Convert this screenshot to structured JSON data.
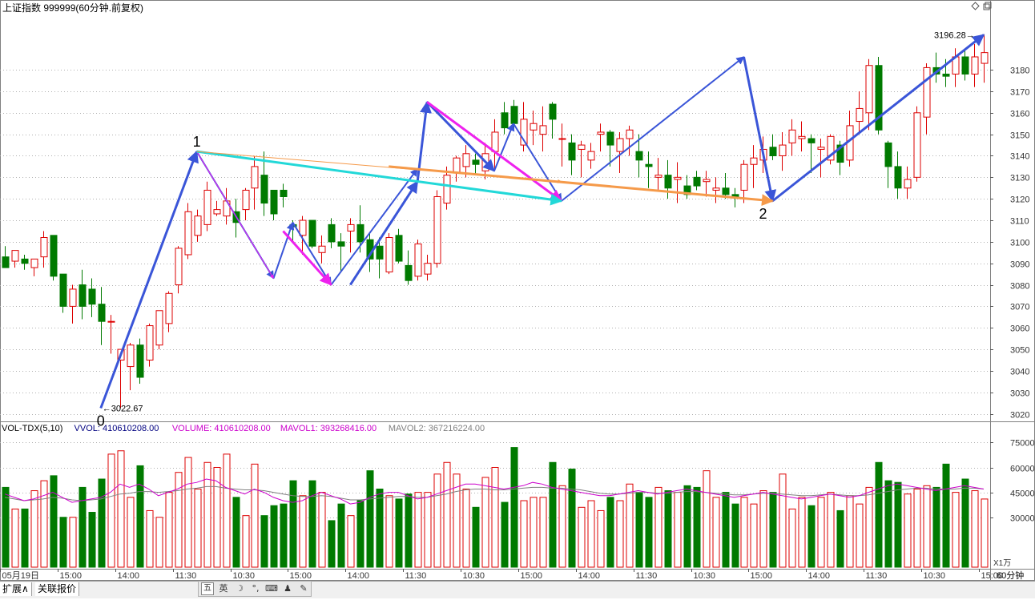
{
  "header": {
    "title": "上证指数 999999(60分钟.前复权)"
  },
  "colors": {
    "up": "#dd0000",
    "down": "#007a00",
    "grid": "#b0b0b0",
    "text": "#000000",
    "axis_text": "#333333",
    "vol_label": "#000080",
    "volume_label": "#cc00cc",
    "mavol1_label": "#cc00cc",
    "mavol2_label": "#808080",
    "arrow_blue": "#3a55d8",
    "arrow_magenta": "#ee22ee",
    "arrow_cyan": "#22d8d8",
    "arrow_orange": "#f59a4a"
  },
  "price_axis": {
    "min": 3018,
    "max": 3205,
    "ticks": [
      3020,
      3030,
      3040,
      3050,
      3060,
      3070,
      3080,
      3090,
      3100,
      3110,
      3120,
      3130,
      3140,
      3150,
      3160,
      3170,
      3180
    ]
  },
  "volume_panel": {
    "indicator_label": "VOL-TDX(5,10)",
    "vvol_label": "VVOL: 410610208.00",
    "volume_label": "VOLUME: 410610208.00",
    "mavol1_label": "MAVOL1: 393268416.00",
    "mavol2_label": "MAVOL2: 367216224.00",
    "axis_ticks": [
      30000,
      45000,
      60000,
      75000
    ],
    "axis_max": 80000,
    "unit_label": "X1万"
  },
  "time_axis": {
    "labels": [
      {
        "index": 0,
        "text": "05月19日"
      },
      {
        "index": 6,
        "text": "15:00"
      },
      {
        "index": 12,
        "text": "14:00"
      },
      {
        "index": 18,
        "text": "11:30"
      },
      {
        "index": 24,
        "text": "10:30"
      },
      {
        "index": 30,
        "text": "15:00"
      },
      {
        "index": 36,
        "text": "14:00"
      },
      {
        "index": 42,
        "text": "11:30"
      },
      {
        "index": 48,
        "text": "10:30"
      },
      {
        "index": 54,
        "text": "15:00"
      },
      {
        "index": 60,
        "text": "14:00"
      },
      {
        "index": 66,
        "text": "11:30"
      },
      {
        "index": 72,
        "text": "10:30"
      },
      {
        "index": 78,
        "text": "15:00"
      },
      {
        "index": 84,
        "text": "14:00"
      },
      {
        "index": 90,
        "text": "11:30"
      },
      {
        "index": 96,
        "text": "10:30"
      },
      {
        "index": 102,
        "text": "15:00"
      }
    ],
    "period_label": "60分钟"
  },
  "annotations": {
    "low_label": "3022.67",
    "high_label": "3196.28",
    "wave_labels": [
      {
        "text": "0",
        "index": 10,
        "price": 3022.67,
        "pos": "below"
      },
      {
        "text": "1",
        "index": 20,
        "price": 3142,
        "pos": "above"
      },
      {
        "text": "2",
        "index": 79,
        "price": 3119,
        "pos": "below"
      }
    ]
  },
  "chart_data": {
    "type": "candlestick",
    "candles": [
      [
        3093,
        3098,
        3088,
        3088,
        48000
      ],
      [
        3091,
        3096,
        3088,
        3096,
        35000
      ],
      [
        3092,
        3094,
        3087,
        3090,
        35000
      ],
      [
        3088,
        3092,
        3084,
        3092,
        46000
      ],
      [
        3093,
        3105,
        3088,
        3102,
        52000
      ],
      [
        3103,
        3103,
        3082,
        3084,
        55000
      ],
      [
        3085,
        3085,
        3067,
        3070,
        30000
      ],
      [
        3070,
        3080,
        3062,
        3078,
        30000
      ],
      [
        3080,
        3087,
        3064,
        3070,
        48000
      ],
      [
        3078,
        3083,
        3065,
        3071,
        33000
      ],
      [
        3071,
        3079,
        3052,
        3063,
        53000
      ],
      [
        3063,
        3066,
        3048,
        3063,
        68000
      ],
      [
        3045,
        3046,
        3022.67,
        3050,
        70000
      ],
      [
        3042,
        3053,
        3031,
        3052,
        42000
      ],
      [
        3052,
        3055,
        3034,
        3037,
        61000
      ],
      [
        3045,
        3062,
        3042,
        3061,
        34000
      ],
      [
        3052,
        3068,
        3050,
        3068,
        30000
      ],
      [
        3062,
        3077,
        3058,
        3076,
        45000
      ],
      [
        3080,
        3098,
        3076,
        3097,
        57000
      ],
      [
        3094,
        3118,
        3092,
        3114,
        66000
      ],
      [
        3103,
        3115,
        3100,
        3112,
        47000
      ],
      [
        3108,
        3128,
        3105,
        3124,
        63000
      ],
      [
        3113,
        3119,
        3112,
        3115,
        60000
      ],
      [
        3112,
        3125,
        3108,
        3119,
        68000
      ],
      [
        3114,
        3120,
        3102,
        3109,
        42000
      ],
      [
        3115,
        3125,
        3110,
        3124,
        31000
      ],
      [
        3125,
        3140,
        3115,
        3135,
        62000
      ],
      [
        3131,
        3142,
        3112,
        3118,
        31000
      ],
      [
        3124,
        3124,
        3110,
        3113,
        37000
      ],
      [
        3124,
        3127,
        3116,
        3121,
        38000
      ],
      [
        3108,
        3110,
        3100,
        3107,
        52000
      ],
      [
        3103,
        3112,
        3094,
        3110,
        43000
      ],
      [
        3110,
        3110,
        3097,
        3098,
        52000
      ],
      [
        3095,
        3103,
        3090,
        3098,
        45000
      ],
      [
        3108,
        3111,
        3097,
        3100,
        28000
      ],
      [
        3100,
        3104,
        3086,
        3098,
        38000
      ],
      [
        3105,
        3111,
        3095,
        3108,
        31000
      ],
      [
        3108,
        3117,
        3095,
        3100,
        40000
      ],
      [
        3101,
        3104,
        3086,
        3092,
        58000
      ],
      [
        3098,
        3102,
        3083,
        3092,
        47000
      ],
      [
        3086,
        3104,
        3085,
        3102,
        43000
      ],
      [
        3103,
        3106,
        3090,
        3091,
        41000
      ],
      [
        3089,
        3096,
        3080,
        3082,
        44000
      ],
      [
        3084,
        3101,
        3082,
        3099,
        45000
      ],
      [
        3085,
        3094,
        3082,
        3090,
        45000
      ],
      [
        3090,
        3124,
        3088,
        3121,
        56000
      ],
      [
        3118,
        3135,
        3115,
        3131,
        63000
      ],
      [
        3132,
        3140,
        3128,
        3139,
        56000
      ],
      [
        3135,
        3145,
        3130,
        3141,
        47000
      ],
      [
        3138,
        3141,
        3131,
        3136,
        36000
      ],
      [
        3133,
        3146,
        3129,
        3141,
        54000
      ],
      [
        3142,
        3157,
        3133,
        3151,
        60000
      ],
      [
        3160,
        3165,
        3150,
        3153,
        39000
      ],
      [
        3163,
        3166,
        3152,
        3155,
        72000
      ],
      [
        3145,
        3165,
        3142,
        3157,
        40000
      ],
      [
        3152,
        3161,
        3145,
        3155,
        42000
      ],
      [
        3150,
        3163,
        3142,
        3154,
        42000
      ],
      [
        3164,
        3165,
        3148,
        3157,
        63000
      ],
      [
        3148,
        3155,
        3135,
        3148,
        49000
      ],
      [
        3146,
        3150,
        3131,
        3138,
        59000
      ],
      [
        3143,
        3147,
        3130,
        3145,
        36000
      ],
      [
        3138,
        3146,
        3134,
        3142,
        40000
      ],
      [
        3150,
        3155,
        3142,
        3151,
        34000
      ],
      [
        3151,
        3152,
        3135,
        3145,
        42000
      ],
      [
        3142,
        3151,
        3132,
        3148,
        40000
      ],
      [
        3148,
        3154,
        3140,
        3152,
        50000
      ],
      [
        3142,
        3150,
        3130,
        3138,
        45000
      ],
      [
        3136,
        3142,
        3125,
        3135,
        42000
      ],
      [
        3130,
        3139,
        3124,
        3131,
        48000
      ],
      [
        3131,
        3138,
        3120,
        3125,
        46000
      ],
      [
        3129,
        3137,
        3118,
        3130,
        45000
      ],
      [
        3126,
        3131,
        3120,
        3122,
        49000
      ],
      [
        3130,
        3133,
        3124,
        3126,
        48000
      ],
      [
        3128,
        3133,
        3121,
        3129,
        58000
      ],
      [
        3124,
        3130,
        3118,
        3125,
        42000
      ],
      [
        3125,
        3132,
        3120,
        3122,
        45000
      ],
      [
        3122,
        3125,
        3116,
        3121,
        38000
      ],
      [
        3124,
        3138,
        3118,
        3136,
        42000
      ],
      [
        3136,
        3145,
        3125,
        3139,
        38000
      ],
      [
        3138,
        3149,
        3132,
        3143,
        46000
      ],
      [
        3144,
        3150,
        3138,
        3140,
        45000
      ],
      [
        3140,
        3151,
        3133,
        3145,
        56000
      ],
      [
        3146,
        3157,
        3140,
        3152,
        35000
      ],
      [
        3148,
        3156,
        3142,
        3149,
        42000
      ],
      [
        3148,
        3150,
        3132,
        3146,
        37000
      ],
      [
        3143,
        3148,
        3130,
        3144,
        42000
      ],
      [
        3138,
        3150,
        3136,
        3149,
        45000
      ],
      [
        3145,
        3147,
        3131,
        3137,
        34000
      ],
      [
        3138,
        3161,
        3135,
        3154,
        43000
      ],
      [
        3156,
        3170,
        3150,
        3162,
        38000
      ],
      [
        3160,
        3185,
        3152,
        3182,
        48000
      ],
      [
        3182,
        3186,
        3150,
        3152,
        63000
      ],
      [
        3146,
        3147,
        3125,
        3135,
        52000
      ],
      [
        3135,
        3142,
        3120,
        3125,
        51000
      ],
      [
        3125,
        3135,
        3120,
        3129,
        44000
      ],
      [
        3130,
        3163,
        3128,
        3160,
        47000
      ],
      [
        3158,
        3183,
        3150,
        3181,
        49000
      ],
      [
        3181,
        3188,
        3174,
        3178,
        48000
      ],
      [
        3178,
        3185,
        3172,
        3177,
        62000
      ],
      [
        3178,
        3190,
        3172,
        3186,
        45000
      ],
      [
        3186,
        3189,
        3175,
        3178,
        53000
      ],
      [
        3178,
        3192,
        3172,
        3186,
        46000
      ],
      [
        3183,
        3196.28,
        3174,
        3188,
        41000
      ]
    ],
    "mavol1": [
      44000,
      42000,
      40000,
      41000,
      43000,
      45000,
      42000,
      39000,
      40000,
      41000,
      42000,
      45000,
      50000,
      48000,
      50000,
      47000,
      43000,
      45000,
      47000,
      50000,
      51000,
      53000,
      52000,
      48000,
      46000,
      44000,
      47000,
      45000,
      42000,
      40000,
      39000,
      40000,
      43000,
      45000,
      43000,
      41000,
      38000,
      39000,
      42000,
      44000,
      45000,
      45000,
      43000,
      41000,
      42000,
      44000,
      46000,
      48000,
      50000,
      50000,
      49000,
      48000,
      47000,
      48000,
      49000,
      51000,
      50000,
      48000,
      47000,
      46000,
      45000,
      44000,
      43000,
      43000,
      44000,
      45000,
      46000,
      45000,
      44000,
      45000,
      46000,
      47000,
      46000,
      45000,
      44000,
      43000,
      42000,
      43000,
      44000,
      45000,
      44000,
      43000,
      42000,
      41000,
      42000,
      43000,
      44000,
      43000,
      42000,
      43000,
      45000,
      47000,
      49000,
      50000,
      49000,
      48000,
      47000,
      46000,
      47000,
      48000,
      49000,
      48000,
      47000
    ],
    "mavol2": [
      42000,
      41000,
      40000,
      40500,
      41000,
      42000,
      41500,
      40500,
      40000,
      40500,
      41000,
      42500,
      44000,
      44500,
      45500,
      45500,
      45000,
      45500,
      46000,
      47000,
      47500,
      48500,
      48500,
      47500,
      47000,
      46500,
      46500,
      46000,
      45000,
      44000,
      43000,
      42500,
      42500,
      43000,
      42500,
      41500,
      40500,
      40500,
      41000,
      41500,
      42000,
      42500,
      42500,
      42000,
      42000,
      43000,
      44000,
      45500,
      46500,
      47000,
      47000,
      46500,
      46500,
      47000,
      47500,
      48000,
      48000,
      47500,
      47500,
      47000,
      46500,
      45500,
      44500,
      44000,
      44000,
      44500,
      45000,
      45000,
      44500,
      44500,
      45000,
      45500,
      45500,
      45000,
      44500,
      44000,
      43500,
      43500,
      44000,
      44500,
      44500,
      44000,
      43500,
      43000,
      43000,
      43500,
      44000,
      43500,
      43000,
      43000,
      43500,
      44500,
      45500,
      46500,
      47000,
      47500,
      47500,
      47000,
      47000,
      47000,
      47500,
      47500,
      47000
    ]
  },
  "drawings": [
    {
      "color": "arrow_blue",
      "width": 3,
      "from": [
        10,
        3022.67
      ],
      "to": [
        20,
        3142
      ]
    },
    {
      "color": "arrow_blue",
      "width": 2,
      "from": [
        20,
        3142
      ],
      "to": [
        28,
        3083
      ]
    },
    {
      "color": "arrow_blue",
      "width": 2,
      "from": [
        28,
        3083
      ],
      "to": [
        30,
        3109
      ]
    },
    {
      "color": "arrow_blue",
      "width": 2,
      "from": [
        30,
        3109
      ],
      "to": [
        34,
        3080
      ]
    },
    {
      "color": "arrow_blue",
      "width": 2,
      "from": [
        34,
        3080
      ],
      "to": [
        43,
        3134
      ]
    },
    {
      "color": "arrow_blue",
      "width": 3,
      "from": [
        36,
        3080
      ],
      "to": [
        43,
        3128
      ]
    },
    {
      "color": "arrow_blue",
      "width": 3,
      "from": [
        43,
        3128
      ],
      "to": [
        44,
        3165
      ]
    },
    {
      "color": "arrow_blue",
      "width": 3,
      "from": [
        44,
        3165
      ],
      "to": [
        51,
        3133
      ]
    },
    {
      "color": "arrow_blue",
      "width": 2,
      "from": [
        51,
        3133
      ],
      "to": [
        53,
        3155
      ]
    },
    {
      "color": "arrow_blue",
      "width": 2,
      "from": [
        53,
        3155
      ],
      "to": [
        58,
        3119
      ]
    },
    {
      "color": "arrow_blue",
      "width": 2,
      "from": [
        58,
        3119
      ],
      "to": [
        77,
        3186
      ]
    },
    {
      "color": "arrow_blue",
      "width": 3,
      "from": [
        77,
        3186
      ],
      "to": [
        80,
        3119
      ]
    },
    {
      "color": "arrow_blue",
      "width": 3,
      "from": [
        80,
        3119
      ],
      "to": [
        102,
        3196.28
      ]
    },
    {
      "color": "arrow_magenta",
      "width": 1,
      "from": [
        20,
        3142
      ],
      "to": [
        28,
        3083
      ]
    },
    {
      "color": "arrow_magenta",
      "width": 3,
      "from": [
        29,
        3105
      ],
      "to": [
        34,
        3080
      ]
    },
    {
      "color": "arrow_magenta",
      "width": 3,
      "from": [
        44,
        3165
      ],
      "to": [
        58,
        3119
      ]
    },
    {
      "color": "arrow_cyan",
      "width": 3,
      "from": [
        20,
        3142
      ],
      "to": [
        58,
        3119
      ]
    },
    {
      "color": "arrow_orange",
      "width": 1,
      "from": [
        20,
        3142
      ],
      "to": [
        58,
        3128
      ]
    },
    {
      "color": "arrow_orange",
      "width": 3,
      "from": [
        40,
        3135
      ],
      "to": [
        80,
        3119
      ]
    }
  ],
  "bottom_bar": {
    "tab1": "扩展∧",
    "tab2": "关联报价"
  },
  "ime_bar": {
    "ime_label": "英"
  }
}
